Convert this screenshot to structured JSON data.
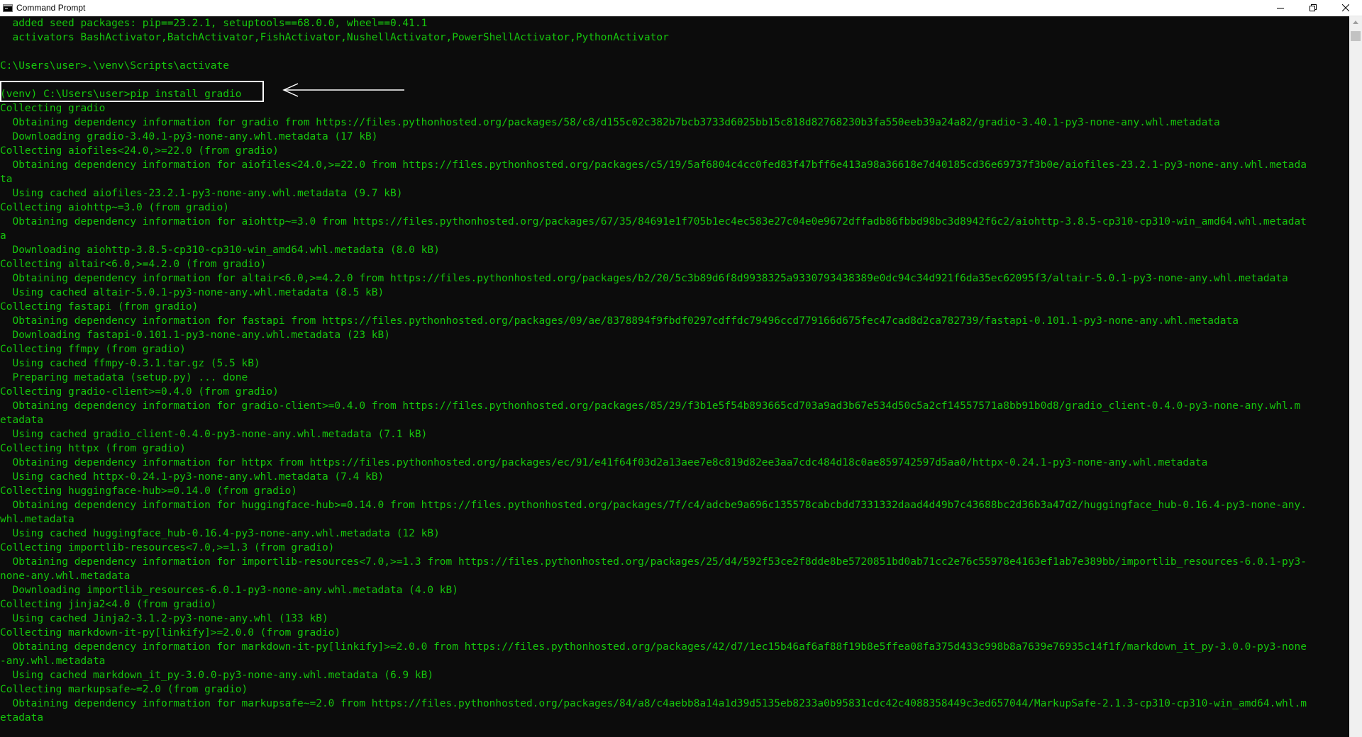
{
  "window": {
    "title": "Command Prompt",
    "icon": "cmd-icon",
    "controls": [
      "minimize-icon",
      "restore-icon",
      "close-icon"
    ]
  },
  "terminal": {
    "text_color": "#16c60c",
    "background": "#0c0c0c",
    "highlight_box_color": "#ffffff",
    "lines": [
      "  added seed packages: pip==23.2.1, setuptools==68.0.0, wheel==0.41.1",
      "  activators BashActivator,BatchActivator,FishActivator,NushellActivator,PowerShellActivator,PythonActivator",
      "",
      "C:\\Users\\user>.\\venv\\Scripts\\activate",
      "",
      "(venv) C:\\Users\\user>pip install gradio",
      "Collecting gradio",
      "  Obtaining dependency information for gradio from https://files.pythonhosted.org/packages/58/c8/d155c02c382b7bcb3733d6025bb15c818d82768230b3fa550eeb39a24a82/gradio-3.40.1-py3-none-any.whl.metadata",
      "  Downloading gradio-3.40.1-py3-none-any.whl.metadata (17 kB)",
      "Collecting aiofiles<24.0,>=22.0 (from gradio)",
      "  Obtaining dependency information for aiofiles<24.0,>=22.0 from https://files.pythonhosted.org/packages/c5/19/5af6804c4cc0fed83f47bff6e413a98a36618e7d40185cd36e69737f3b0e/aiofiles-23.2.1-py3-none-any.whl.metada",
      "ta",
      "  Using cached aiofiles-23.2.1-py3-none-any.whl.metadata (9.7 kB)",
      "Collecting aiohttp~=3.0 (from gradio)",
      "  Obtaining dependency information for aiohttp~=3.0 from https://files.pythonhosted.org/packages/67/35/84691e1f705b1ec4ec583e27c04e0e9672dffadb86fbbd98bc3d8942f6c2/aiohttp-3.8.5-cp310-cp310-win_amd64.whl.metadat",
      "a",
      "  Downloading aiohttp-3.8.5-cp310-cp310-win_amd64.whl.metadata (8.0 kB)",
      "Collecting altair<6.0,>=4.2.0 (from gradio)",
      "  Obtaining dependency information for altair<6.0,>=4.2.0 from https://files.pythonhosted.org/packages/b2/20/5c3b89d6f8d9938325a9330793438389e0dc94c34d921f6da35ec62095f3/altair-5.0.1-py3-none-any.whl.metadata",
      "  Using cached altair-5.0.1-py3-none-any.whl.metadata (8.5 kB)",
      "Collecting fastapi (from gradio)",
      "  Obtaining dependency information for fastapi from https://files.pythonhosted.org/packages/09/ae/8378894f9fbdf0297cdffdc79496ccd779166d675fec47cad8d2ca782739/fastapi-0.101.1-py3-none-any.whl.metadata",
      "  Downloading fastapi-0.101.1-py3-none-any.whl.metadata (23 kB)",
      "Collecting ffmpy (from gradio)",
      "  Using cached ffmpy-0.3.1.tar.gz (5.5 kB)",
      "  Preparing metadata (setup.py) ... done",
      "Collecting gradio-client>=0.4.0 (from gradio)",
      "  Obtaining dependency information for gradio-client>=0.4.0 from https://files.pythonhosted.org/packages/85/29/f3b1e5f54b893665cd703a9ad3b67e534d50c5a2cf14557571a8bb91b0d8/gradio_client-0.4.0-py3-none-any.whl.m",
      "etadata",
      "  Using cached gradio_client-0.4.0-py3-none-any.whl.metadata (7.1 kB)",
      "Collecting httpx (from gradio)",
      "  Obtaining dependency information for httpx from https://files.pythonhosted.org/packages/ec/91/e41f64f03d2a13aee7e8c819d82ee3aa7cdc484d18c0ae859742597d5aa0/httpx-0.24.1-py3-none-any.whl.metadata",
      "  Using cached httpx-0.24.1-py3-none-any.whl.metadata (7.4 kB)",
      "Collecting huggingface-hub>=0.14.0 (from gradio)",
      "  Obtaining dependency information for huggingface-hub>=0.14.0 from https://files.pythonhosted.org/packages/7f/c4/adcbe9a696c135578cabcbdd7331332daad4d49b7c43688bc2d36b3a47d2/huggingface_hub-0.16.4-py3-none-any.",
      "whl.metadata",
      "  Using cached huggingface_hub-0.16.4-py3-none-any.whl.metadata (12 kB)",
      "Collecting importlib-resources<7.0,>=1.3 (from gradio)",
      "  Obtaining dependency information for importlib-resources<7.0,>=1.3 from https://files.pythonhosted.org/packages/25/d4/592f53ce2f8dde8be5720851bd0ab71cc2e76c55978e4163ef1ab7e389bb/importlib_resources-6.0.1-py3-",
      "none-any.whl.metadata",
      "  Downloading importlib_resources-6.0.1-py3-none-any.whl.metadata (4.0 kB)",
      "Collecting jinja2<4.0 (from gradio)",
      "  Using cached Jinja2-3.1.2-py3-none-any.whl (133 kB)",
      "Collecting markdown-it-py[linkify]>=2.0.0 (from gradio)",
      "  Obtaining dependency information for markdown-it-py[linkify]>=2.0.0 from https://files.pythonhosted.org/packages/42/d7/1ec15b46af6af88f19b8e5ffea08fa375d433c998b8a7639e76935c14f1f/markdown_it_py-3.0.0-py3-none",
      "-any.whl.metadata",
      "  Using cached markdown_it_py-3.0.0-py3-none-any.whl.metadata (6.9 kB)",
      "Collecting markupsafe~=2.0 (from gradio)",
      "  Obtaining dependency information for markupsafe~=2.0 from https://files.pythonhosted.org/packages/84/a8/c4aebb8a14a1d39d5135eb8233a0b95831cdc42c4088358449c3ed657044/MarkupSafe-2.1.3-cp310-cp310-win_amd64.whl.m",
      "etadata"
    ]
  }
}
